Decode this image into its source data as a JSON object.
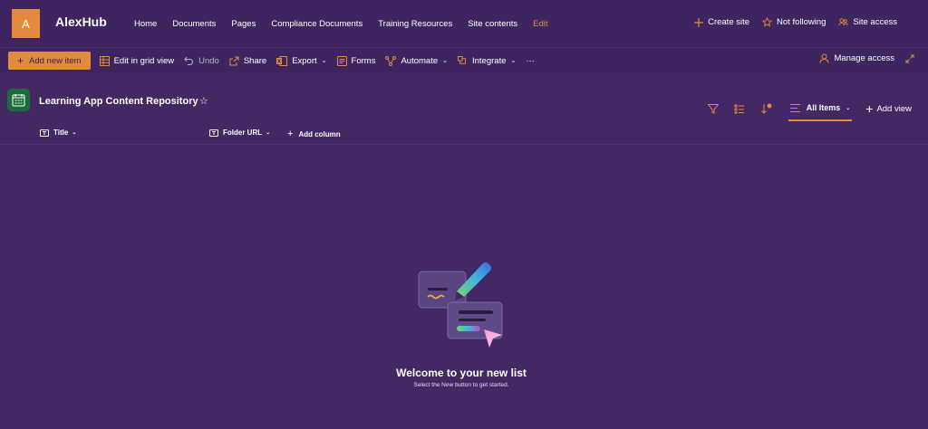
{
  "site": {
    "logo_letter": "A",
    "title": "AlexHub",
    "nav": [
      "Home",
      "Documents",
      "Pages",
      "Compliance Documents",
      "Training Resources",
      "Site contents",
      "Edit"
    ],
    "actions": {
      "create_site": "Create site",
      "following": "Not following",
      "site_access": "Site access"
    }
  },
  "command_bar": {
    "new_item": "Add new item",
    "grid_view": "Edit in grid view",
    "undo": "Undo",
    "share": "Share",
    "export": "Export",
    "forms": "Forms",
    "automate": "Automate",
    "integrate": "Integrate",
    "more": "···",
    "manage_access": "Manage access"
  },
  "list": {
    "title": "Learning App Content Repository",
    "favorite": "☆",
    "view_name": "All Items",
    "add_view": "Add view"
  },
  "columns": {
    "title": "Title",
    "folder_url": "Folder URL",
    "add_column": "Add column"
  },
  "empty_state": {
    "title": "Welcome to your new list",
    "subtitle": "Select the New button to get started."
  },
  "colors": {
    "background": "#442864",
    "header": "#3e2560",
    "accent": "#e38a3c"
  }
}
